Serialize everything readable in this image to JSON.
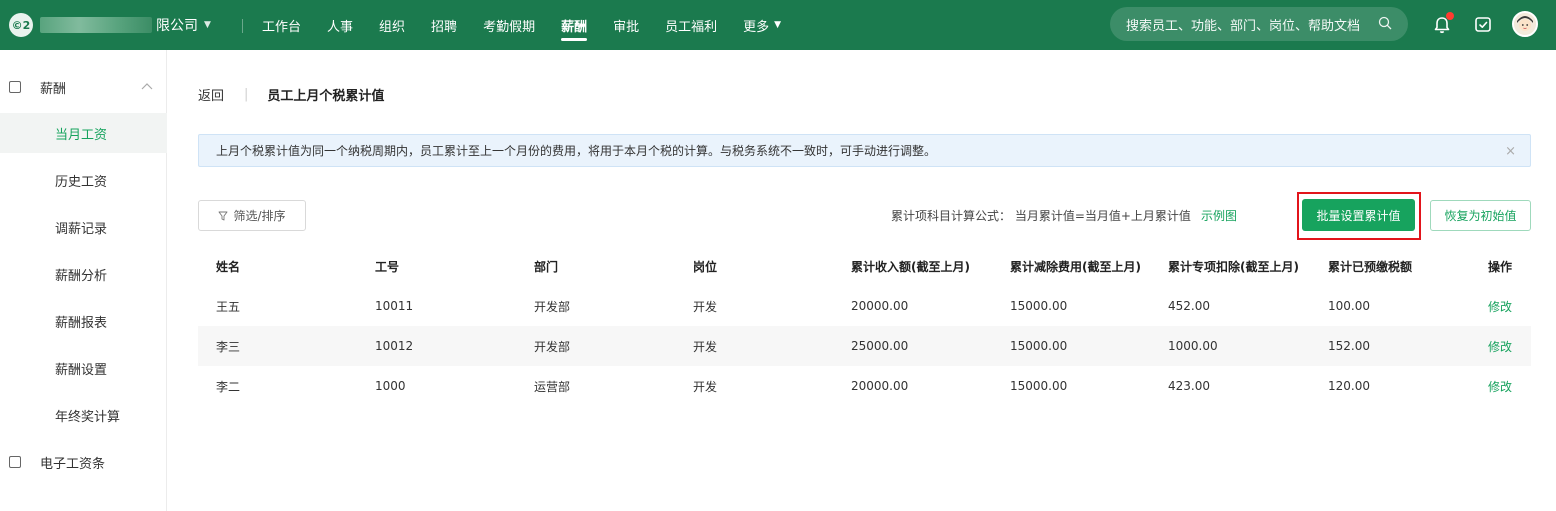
{
  "topbar": {
    "logo_text": "©2",
    "company_suffix": "限公司",
    "nav": [
      {
        "label": "工作台",
        "active": false
      },
      {
        "label": "人事",
        "active": false
      },
      {
        "label": "组织",
        "active": false
      },
      {
        "label": "招聘",
        "active": false
      },
      {
        "label": "考勤假期",
        "active": false
      },
      {
        "label": "薪酬",
        "active": true
      },
      {
        "label": "审批",
        "active": false
      },
      {
        "label": "员工福利",
        "active": false
      },
      {
        "label": "更多",
        "active": false
      }
    ],
    "search_placeholder": "搜索员工、功能、部门、岗位、帮助文档",
    "icons": [
      "search-icon",
      "bell-icon",
      "feedback-icon",
      "avatar"
    ]
  },
  "sidebar": {
    "group_salary": "薪酬",
    "items": [
      {
        "label": "当月工资",
        "active": true
      },
      {
        "label": "历史工资",
        "active": false
      },
      {
        "label": "调薪记录",
        "active": false
      },
      {
        "label": "薪酬分析",
        "active": false
      },
      {
        "label": "薪酬报表",
        "active": false
      },
      {
        "label": "薪酬设置",
        "active": false
      },
      {
        "label": "年终奖计算",
        "active": false
      }
    ],
    "group_payslip": "电子工资条"
  },
  "breadcrumb": {
    "back": "返回",
    "separator": "|",
    "title": "员工上月个税累计值"
  },
  "notice": {
    "text": "上月个税累计值为同一个纳税周期内，员工累计至上一个月份的费用，将用于本月个税的计算。与税务系统不一致时，可手动进行调整。",
    "close": "×"
  },
  "toolbar": {
    "filter_label": "筛选/排序",
    "formula_text": "累计项科目计算公式： 当月累计值=当月值+上月累计值",
    "example_link": "示例图",
    "batch_button": "批量设置累计值",
    "reset_button": "恢复为初始值"
  },
  "table": {
    "headers": [
      "姓名",
      "工号",
      "部门",
      "岗位",
      "累计收入额(截至上月)",
      "累计减除费用(截至上月)",
      "累计专项扣除(截至上月)",
      "累计已预缴税额",
      "操作"
    ],
    "rows": [
      [
        "王五",
        "10011",
        "开发部",
        "开发",
        "20000.00",
        "15000.00",
        "452.00",
        "100.00",
        "修改"
      ],
      [
        "李三",
        "10012",
        "开发部",
        "开发",
        "25000.00",
        "15000.00",
        "1000.00",
        "152.00",
        "修改"
      ],
      [
        "李二",
        "1000",
        "运营部",
        "开发",
        "20000.00",
        "15000.00",
        "423.00",
        "120.00",
        "修改"
      ]
    ]
  },
  "colors": {
    "topbar": "#1b7a4e",
    "accent": "#17a35e",
    "highlight": "#e2141b",
    "notice_bg": "#eaf3fc"
  }
}
